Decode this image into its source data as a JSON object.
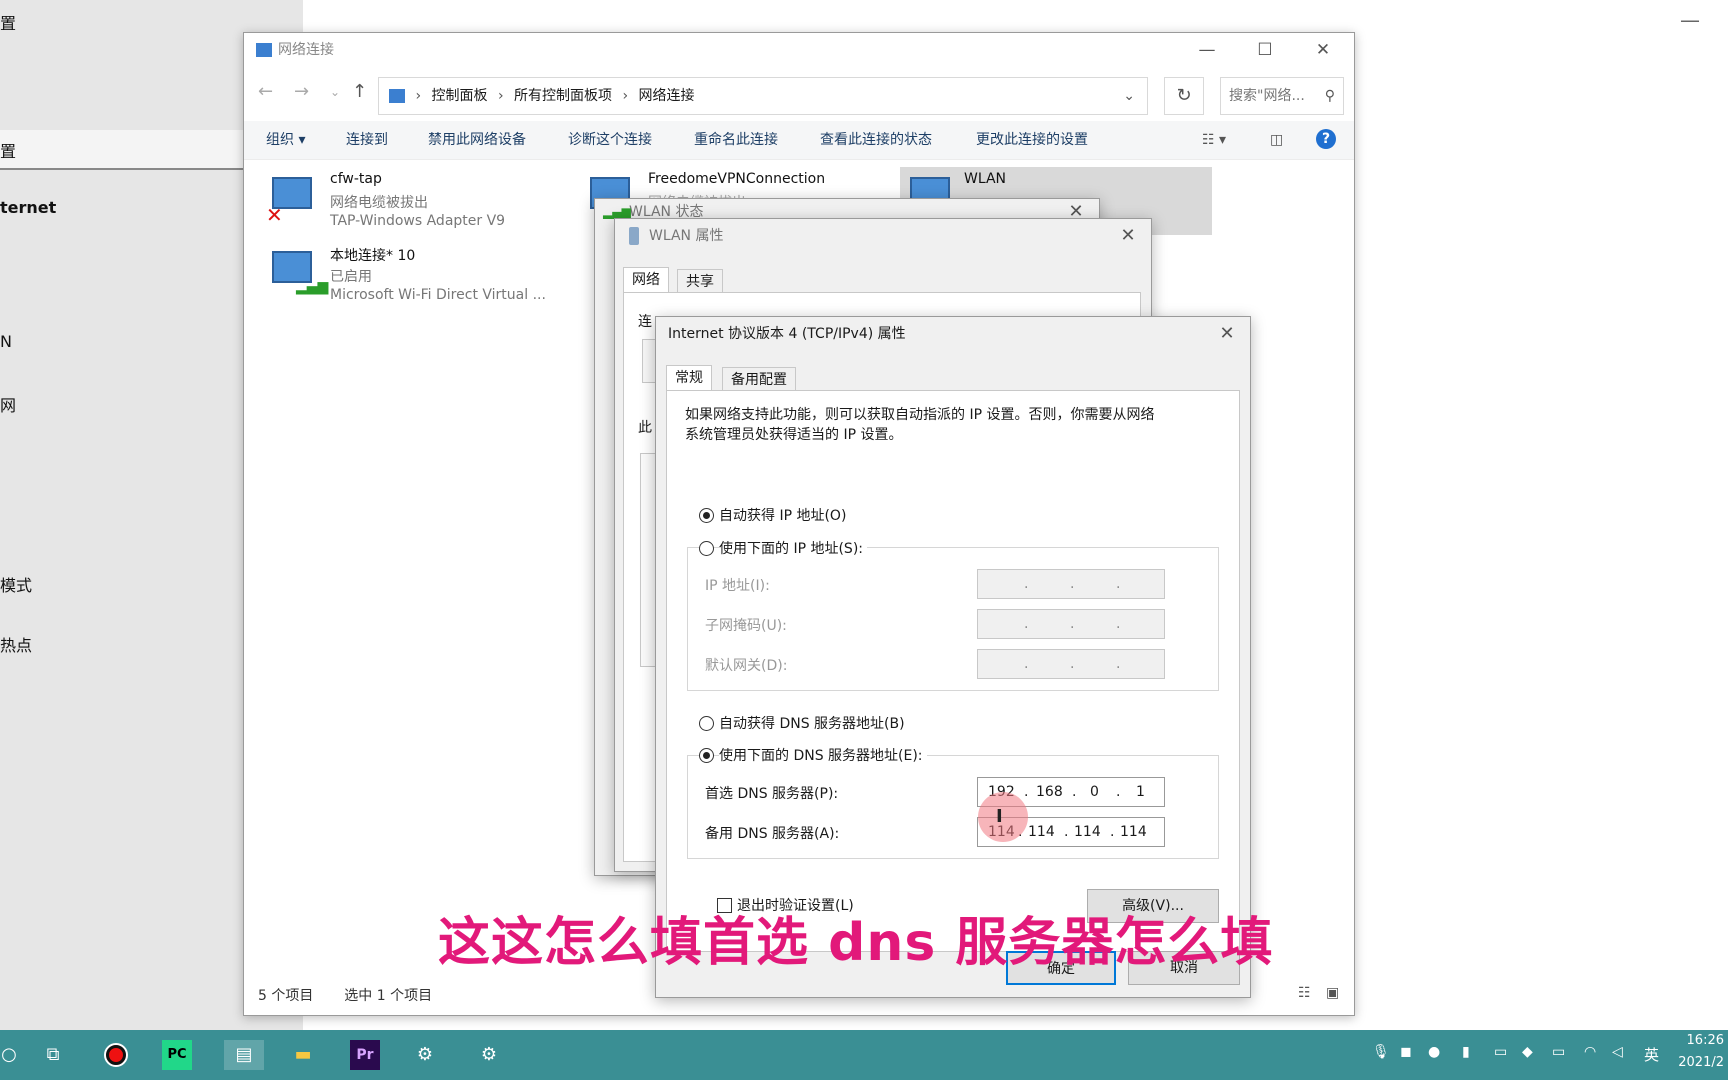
{
  "left_panel": {
    "items": [
      "置",
      "置",
      "ternet",
      "N",
      "网",
      "模式",
      "热点"
    ]
  },
  "explorer": {
    "title": "网络连接",
    "breadcrumbs": [
      "控制面板",
      "所有控制面板项",
      "网络连接"
    ],
    "search_placeholder": "搜索\"网络...",
    "toolbar": [
      "组织 ▾",
      "连接到",
      "禁用此网络设备",
      "诊断这个连接",
      "重命名此连接",
      "查看此连接的状态",
      "更改此连接的设置"
    ],
    "items": [
      {
        "name": "cfw-tap",
        "status": "网络电缆被拔出",
        "device": "TAP-Windows Adapter V9"
      },
      {
        "name": "本地连接* 10",
        "status": "已启用",
        "device": "Microsoft Wi-Fi Direct Virtual ..."
      },
      {
        "name": "FreedomeVPNConnection",
        "status": "网络电缆被拔出",
        "device": ""
      },
      {
        "name": "WLAN",
        "status": "",
        "device": ""
      }
    ],
    "status_count": "5 个项目",
    "status_selected": "选中 1 个项目"
  },
  "wlan_status": {
    "title": "WLAN 状态"
  },
  "wlan_props": {
    "title": "WLAN 属性",
    "tabs": [
      "网络",
      "共享"
    ],
    "fragment_connect": "连",
    "fragment_this": "此"
  },
  "ipv4": {
    "title": "Internet 协议版本 4 (TCP/IPv4) 属性",
    "tabs": [
      "常规",
      "备用配置"
    ],
    "description": "如果网络支持此功能，则可以获取自动指派的 IP 设置。否则，你需要从网络系统管理员处获得适当的 IP 设置。",
    "desc_line1": "如果网络支持此功能，则可以获取自动指派的 IP 设置。否则，你需要从网络",
    "desc_line2": "系统管理员处获得适当的 IP 设置。",
    "radio_auto_ip": "自动获得 IP 地址(O)",
    "radio_manual_ip": "使用下面的 IP 地址(S):",
    "label_ip": "IP 地址(I):",
    "label_mask": "子网掩码(U):",
    "label_gateway": "默认网关(D):",
    "radio_auto_dns": "自动获得 DNS 服务器地址(B)",
    "radio_manual_dns": "使用下面的 DNS 服务器地址(E):",
    "label_pref_dns": "首选 DNS 服务器(P):",
    "label_alt_dns": "备用 DNS 服务器(A):",
    "pref_dns": [
      "192",
      "168",
      "0",
      "1"
    ],
    "alt_dns": [
      "114",
      "114",
      "114",
      "114"
    ],
    "dot": ".",
    "validate_label": "退出时验证设置(L)",
    "advanced": "高级(V)...",
    "ok": "确定",
    "cancel": "取消"
  },
  "caption": "这这怎么填首选 dns 服务器怎么填",
  "tray": {
    "ime": "英",
    "time": "16:26",
    "date": "2021/2"
  }
}
